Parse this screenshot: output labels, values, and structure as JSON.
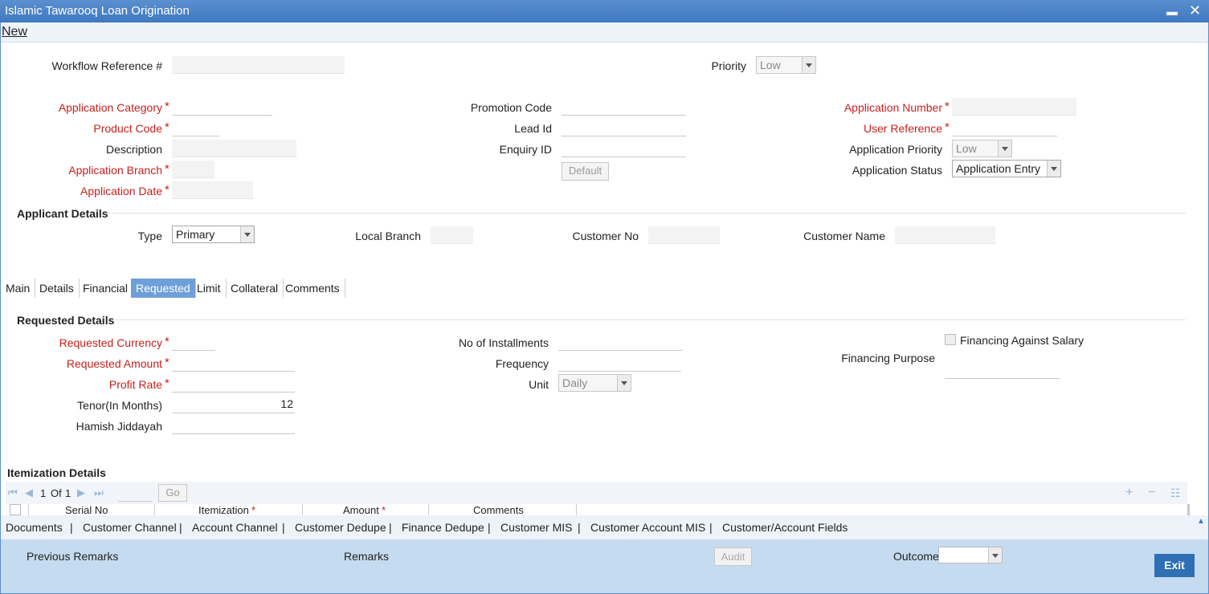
{
  "window": {
    "title": "Islamic Tawarooq Loan Origination",
    "minimize": "▬",
    "close": "✕"
  },
  "menu": {
    "new": "New"
  },
  "workflow": {
    "ref_label": "Workflow Reference #",
    "ref_value": "",
    "priority_label": "Priority",
    "priority_value": "Low"
  },
  "col1": {
    "application_category": "Application Category",
    "product_code": "Product Code",
    "description": "Description",
    "application_branch": "Application Branch",
    "application_date": "Application Date"
  },
  "col2": {
    "promotion_code": "Promotion Code",
    "lead_id": "Lead Id",
    "enquiry_id": "Enquiry ID",
    "default_button": "Default"
  },
  "col3": {
    "application_number": "Application Number",
    "user_reference": "User Reference",
    "application_priority": "Application Priority",
    "application_priority_value": "Low",
    "application_status": "Application Status",
    "application_status_value": "Application Entry"
  },
  "applicant": {
    "title": "Applicant Details",
    "type_label": "Type",
    "type_value": "Primary",
    "local_branch": "Local Branch",
    "customer_no": "Customer No",
    "customer_name": "Customer Name"
  },
  "tabs": [
    "Main",
    "Details",
    "Financial",
    "Requested",
    "Limit",
    "Collateral",
    "Comments"
  ],
  "requested": {
    "title": "Requested Details",
    "currency": "Requested Currency",
    "amount": "Requested Amount",
    "profit_rate": "Profit Rate",
    "tenor": "Tenor(In Months)",
    "tenor_value": "12",
    "hamish": "Hamish Jiddayah",
    "installments": "No of Installments",
    "frequency": "Frequency",
    "unit": "Unit",
    "unit_value": "Daily",
    "financing_against_salary": "Financing Against Salary",
    "financing_purpose": "Financing Purpose"
  },
  "itemization": {
    "title": "Itemization Details",
    "page_num": "1",
    "of_label": "Of",
    "page_total": "1",
    "go": "Go",
    "columns": [
      "Serial No",
      "Itemization",
      "Amount",
      "Comments"
    ]
  },
  "links": [
    "Documents",
    "Customer Channel",
    "Account Channel",
    "Customer Dedupe",
    "Finance Dedupe",
    "Customer MIS",
    "Customer Account MIS",
    "Customer/Account Fields"
  ],
  "footer": {
    "previous_remarks": "Previous Remarks",
    "remarks": "Remarks",
    "audit": "Audit",
    "outcome": "Outcome",
    "exit": "Exit"
  }
}
